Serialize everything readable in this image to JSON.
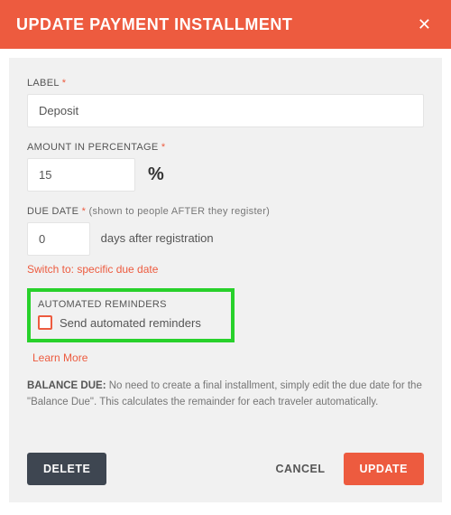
{
  "header": {
    "title": "UPDATE PAYMENT INSTALLMENT",
    "close_glyph": "✕"
  },
  "form": {
    "label_field": {
      "label": "LABEL",
      "required_mark": "*",
      "value": "Deposit"
    },
    "amount_field": {
      "label": "AMOUNT IN PERCENTAGE",
      "required_mark": "*",
      "value": "15",
      "symbol": "%"
    },
    "due_date_field": {
      "label": "DUE DATE",
      "required_mark": "*",
      "hint": "(shown to people AFTER they register)",
      "value": "0",
      "suffix": "days after registration"
    },
    "switch_link": "Switch to: specific due date",
    "reminders": {
      "label": "AUTOMATED REMINDERS",
      "checkbox_label": "Send automated reminders",
      "checked": false
    },
    "learn_more": "Learn More",
    "balance_note": {
      "heading": "BALANCE DUE:",
      "text": " No need to create a final installment, simply edit the due date for the \"Balance Due\". This calculates the remainder for each traveler automatically."
    }
  },
  "footer": {
    "delete": "DELETE",
    "cancel": "CANCEL",
    "update": "UPDATE"
  }
}
